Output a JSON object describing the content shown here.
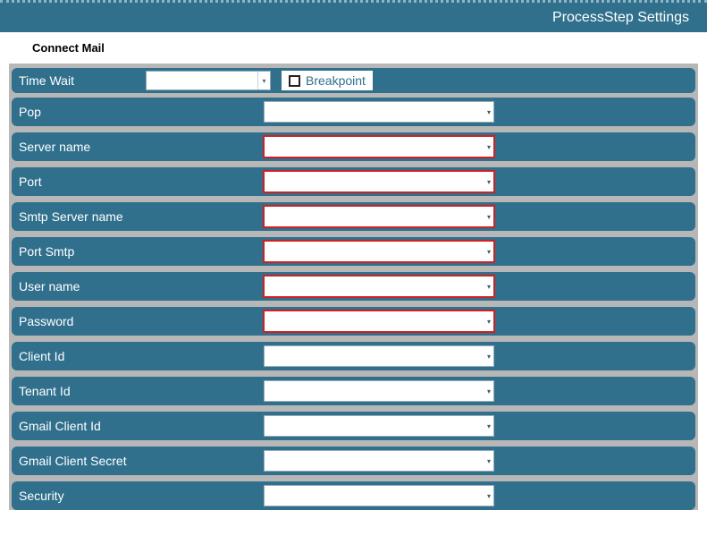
{
  "header": {
    "title": "ProcessStep Settings"
  },
  "section": {
    "title": "Connect Mail"
  },
  "firstRow": {
    "timeWaitLabel": "Time Wait",
    "timeWaitValue": "",
    "breakpointLabel": "Breakpoint",
    "breakpointChecked": false
  },
  "fields": [
    {
      "label": "Pop",
      "value": "",
      "required": false
    },
    {
      "label": "Server name",
      "value": "",
      "required": true
    },
    {
      "label": "Port",
      "value": "",
      "required": true
    },
    {
      "label": "Smtp Server name",
      "value": "",
      "required": true
    },
    {
      "label": "Port Smtp",
      "value": "",
      "required": true
    },
    {
      "label": "User name",
      "value": "",
      "required": true
    },
    {
      "label": "Password",
      "value": "",
      "required": true
    },
    {
      "label": "Client Id",
      "value": "",
      "required": false
    },
    {
      "label": "Tenant Id",
      "value": "",
      "required": false
    },
    {
      "label": "Gmail Client Id",
      "value": "",
      "required": false
    },
    {
      "label": "Gmail Client Secret",
      "value": "",
      "required": false
    },
    {
      "label": "Security",
      "value": "",
      "required": false
    }
  ]
}
